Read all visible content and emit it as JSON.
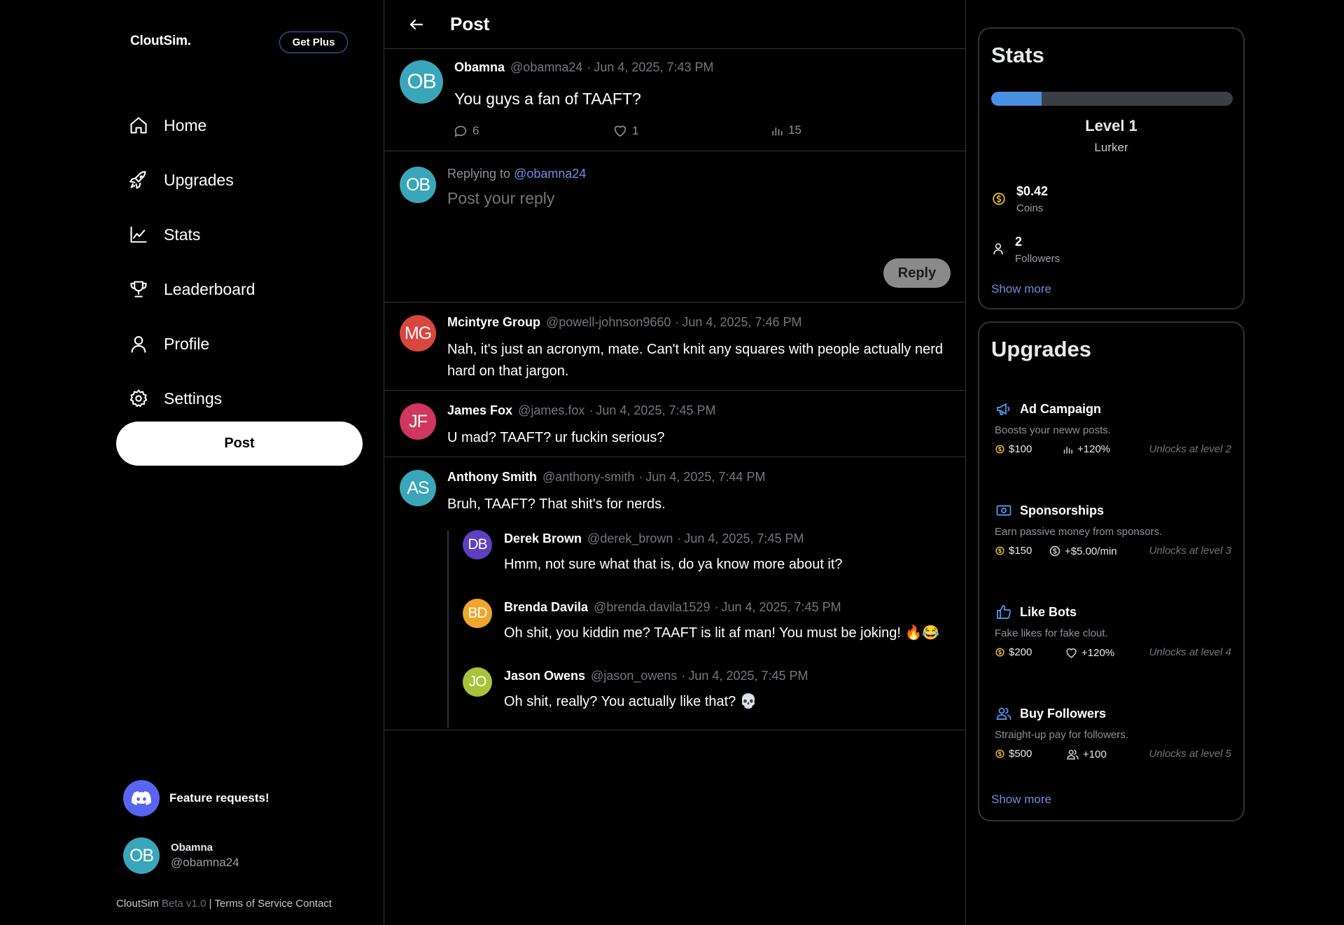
{
  "app": {
    "brand": "CloutSim.",
    "get_plus": "Get Plus",
    "post_button": "Post"
  },
  "nav": [
    {
      "label": "Home",
      "icon": "home-icon"
    },
    {
      "label": "Upgrades",
      "icon": "rocket-icon"
    },
    {
      "label": "Stats",
      "icon": "chart-line-icon"
    },
    {
      "label": "Leaderboard",
      "icon": "trophy-icon"
    },
    {
      "label": "Profile",
      "icon": "user-icon"
    },
    {
      "label": "Settings",
      "icon": "gear-icon"
    }
  ],
  "feature_requests": "Feature requests!",
  "current_user": {
    "initials": "OB",
    "name": "Obamna",
    "handle": "@obamna24",
    "color": "#3aa6b9"
  },
  "footer": {
    "brand": "CloutSim",
    "version": "Beta v1.0",
    "sep": "|",
    "terms": "Terms of Service",
    "contact": "Contact"
  },
  "header": {
    "title": "Post"
  },
  "post": {
    "initials": "OB",
    "color": "#3aa6b9",
    "name": "Obamna",
    "handle": "@obamna24",
    "time": "Jun 4, 2025, 7:43 PM",
    "text": "You guys a fan of TAAFT?",
    "comments": "6",
    "likes": "1",
    "views": "15"
  },
  "reply": {
    "replying_prefix": "Replying to",
    "replying_handle": "@obamna24",
    "placeholder": "Post your reply",
    "button": "Reply"
  },
  "comments": [
    {
      "initials": "MG",
      "color": "#d9463e",
      "name": "Mcintyre Group",
      "handle": "@powell-johnson9660",
      "time": "Jun 4, 2025, 7:46 PM",
      "text": "Nah, it's just an acronym, mate. Can't knit any squares with people actually nerd hard on that jargon."
    },
    {
      "initials": "JF",
      "color": "#d0365f",
      "name": "James Fox",
      "handle": "@james.fox",
      "time": "Jun 4, 2025, 7:45 PM",
      "text": "U mad? TAAFT? ur fuckin serious?"
    },
    {
      "initials": "AS",
      "color": "#3aa6b9",
      "name": "Anthony Smith",
      "handle": "@anthony-smith",
      "time": "Jun 4, 2025, 7:44 PM",
      "text": "Bruh, TAAFT? That shit's for nerds.",
      "replies": [
        {
          "initials": "DB",
          "color": "#5e3fbf",
          "name": "Derek Brown",
          "handle": "@derek_brown",
          "time": "Jun 4, 2025, 7:45 PM",
          "text": "Hmm, not sure what that is, do ya know more about it?"
        },
        {
          "initials": "BD",
          "color": "#f0a52c",
          "name": "Brenda Davila",
          "handle": "@brenda.davila1529",
          "time": "Jun 4, 2025, 7:45 PM",
          "text": "Oh shit, you kiddin me? TAAFT is lit af man! You must be joking! 🔥😂"
        },
        {
          "initials": "JO",
          "color": "#a8c23a",
          "name": "Jason Owens",
          "handle": "@jason_owens",
          "time": "Jun 4, 2025, 7:45 PM",
          "text": "Oh shit, really? You actually like that? 💀"
        }
      ]
    }
  ],
  "stats": {
    "title": "Stats",
    "progress": 0.21,
    "level": "Level 1",
    "rank": "Lurker",
    "coins_value": "$0.42",
    "coins_label": "Coins",
    "followers_value": "2",
    "followers_label": "Followers",
    "show_more": "Show more"
  },
  "upgrades": {
    "title": "Upgrades",
    "show_more": "Show more",
    "items": [
      {
        "name": "Ad Campaign",
        "icon": "megaphone-icon",
        "desc": "Boosts your neww posts.",
        "cost": "$100",
        "effect_icon": "bar-chart-icon",
        "effect": "+120%",
        "unlock": "Unlocks at level 2"
      },
      {
        "name": "Sponsorships",
        "icon": "money-icon",
        "desc": "Earn passive money from sponsors.",
        "cost": "$150",
        "effect_icon": "coin-icon",
        "effect": "+$5.00/min",
        "unlock": "Unlocks at level 3"
      },
      {
        "name": "Like Bots",
        "icon": "thumbs-up-icon",
        "desc": "Fake likes for fake clout.",
        "cost": "$200",
        "effect_icon": "heart-icon",
        "effect": "+120%",
        "unlock": "Unlocks at level 4"
      },
      {
        "name": "Buy Followers",
        "icon": "users-icon",
        "desc": "Straight-up pay for followers.",
        "cost": "$500",
        "effect_icon": "users-icon",
        "effect": "+100",
        "unlock": "Unlocks at level 5"
      }
    ]
  },
  "colors": {
    "accent_blue": "#4a90e2",
    "link": "#6b8fe0",
    "coin": "#e5b93a",
    "discord": "#5865f2"
  }
}
